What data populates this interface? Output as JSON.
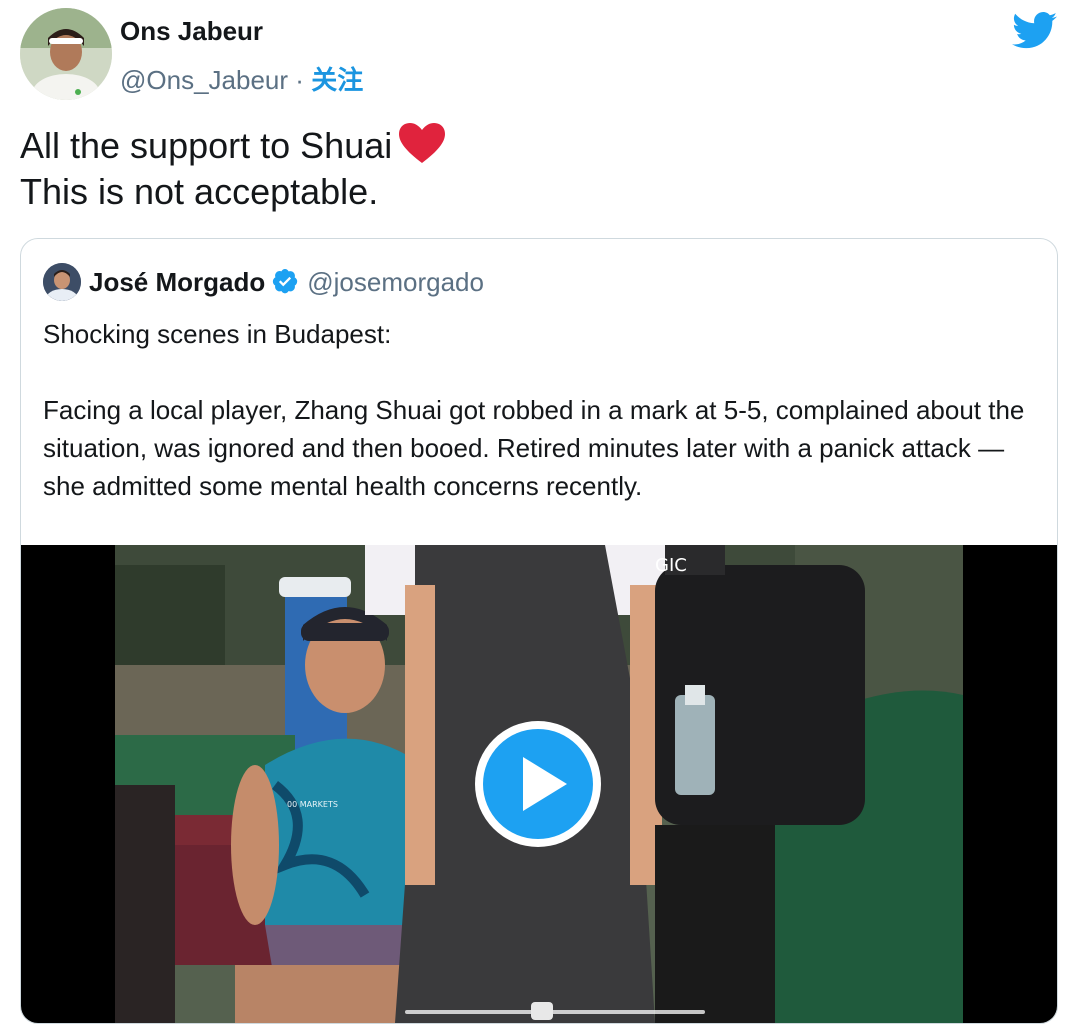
{
  "tweet": {
    "author_name": "Ons Jabeur",
    "author_handle": "@Ons_Jabeur",
    "separator": "·",
    "follow_label": "关注",
    "text_line1": "All the support to Shuai",
    "text_line2": "This is not acceptable.",
    "emoji": "red-heart",
    "brand_icon": "twitter-bird-icon",
    "brand_color": "#1da1f2"
  },
  "quote": {
    "author_name": "José Morgado",
    "verified": true,
    "author_handle": "@josemorgado",
    "text_para1": "Shocking scenes in Budapest:",
    "text_para2": "Facing a local player, Zhang Shuai got robbed in a mark at 5-5, complained about the situation, was ignored and then booed. Retired minutes later with a panick attack — she admitted some mental health concerns recently.",
    "video_overlay_text": "GIC",
    "media_logo_text": "00 MARKETS"
  },
  "video": {
    "play_icon": "play-icon",
    "accent_color": "#1da1f2"
  }
}
